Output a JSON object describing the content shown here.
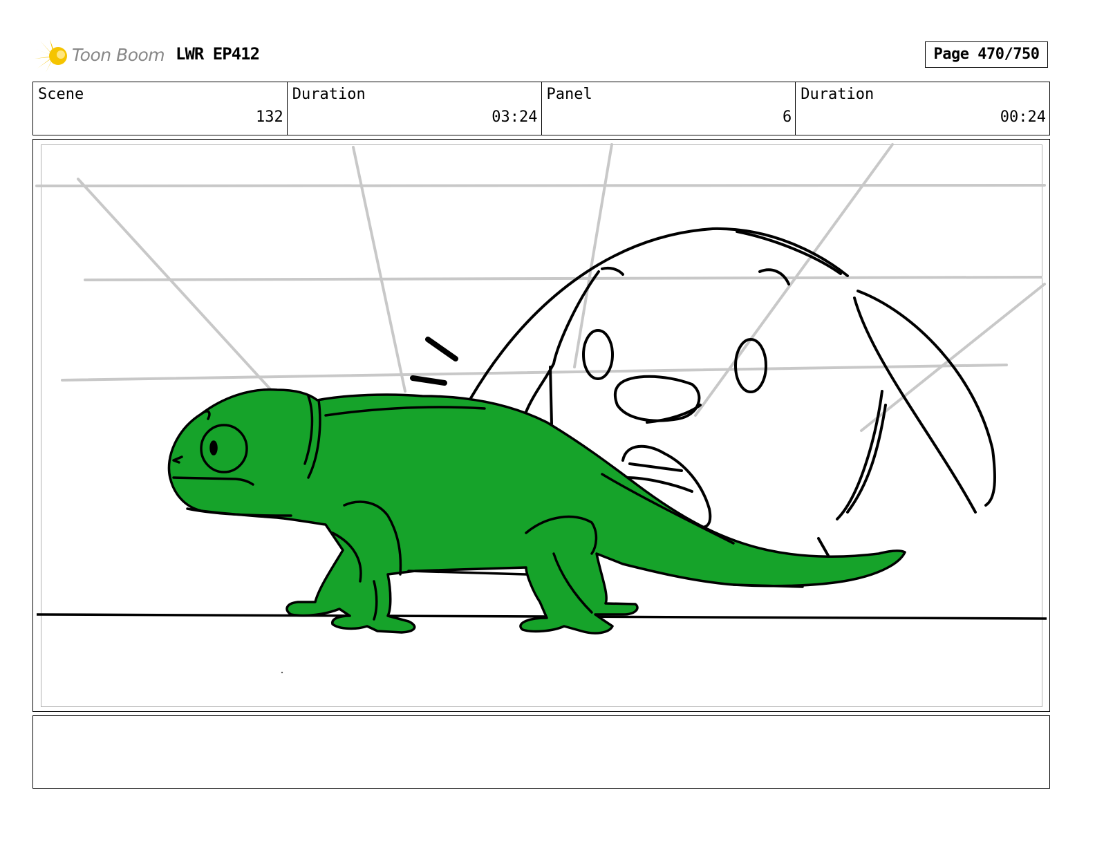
{
  "header": {
    "logo_text": "Toon Boom",
    "title": "LWR EP412",
    "page_label": "Page 470/750"
  },
  "info": {
    "scene_label": "Scene",
    "scene_value": "132",
    "scene_duration_label": "Duration",
    "scene_duration_value": "03:24",
    "panel_label": "Panel",
    "panel_value": "6",
    "panel_duration_label": "Duration",
    "panel_duration_value": "00:24"
  },
  "colors": {
    "logo_star": "#f5c400",
    "logo_text": "#888888",
    "chameleon_fill": "#16a32a",
    "perspective_lines": "#c8c8c8",
    "ink": "#000000"
  },
  "notes": {
    "text": ""
  }
}
